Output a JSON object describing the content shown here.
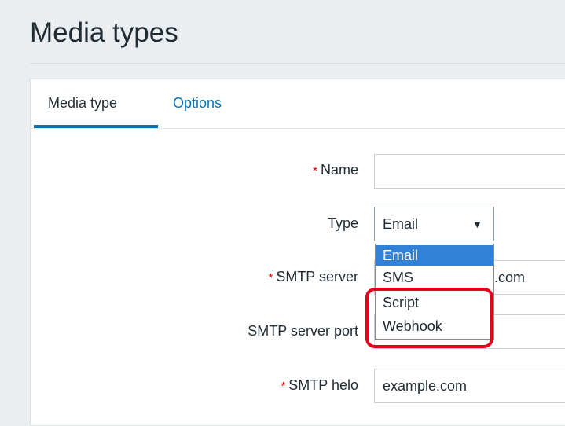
{
  "page": {
    "title": "Media types"
  },
  "tabs": [
    {
      "label": "Media type",
      "active": true
    },
    {
      "label": "Options",
      "active": false
    }
  ],
  "form": {
    "name": {
      "label": "Name",
      "required": true,
      "value": ""
    },
    "type": {
      "label": "Type",
      "value": "Email"
    },
    "smtp_server": {
      "label": "SMTP server",
      "required": true,
      "value_suffix": ".com"
    },
    "smtp_port": {
      "label": "SMTP server port"
    },
    "smtp_helo": {
      "label": "SMTP helo",
      "required": true,
      "value": "example.com"
    },
    "required_marker": "*"
  },
  "type_dropdown": {
    "options": [
      "Email",
      "SMS",
      "Script",
      "Webhook"
    ],
    "selected": "Email"
  },
  "colors": {
    "accent": "#0275b8",
    "required": "#d40000",
    "selected_option": "#3182d6",
    "highlight": "#e4001b"
  }
}
